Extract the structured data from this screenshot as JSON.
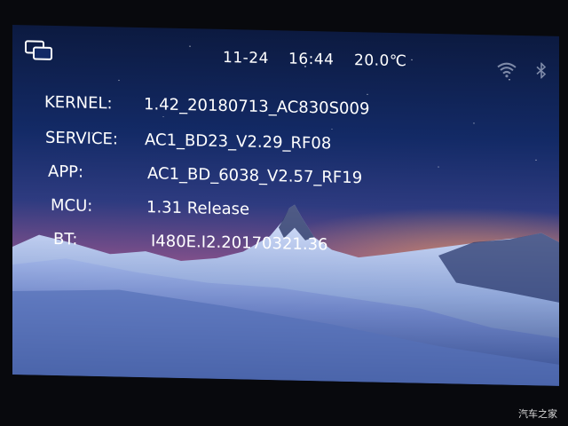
{
  "status_bar": {
    "window_icon": "window-switch-icon",
    "date": "11-24",
    "time": "16:44",
    "temperature": "20.0℃",
    "wifi_icon": "wifi-icon",
    "bluetooth_icon": "bluetooth-icon"
  },
  "version_info": {
    "kernel": {
      "label": "KERNEL:",
      "value": "1.42_20180713_AC830S009"
    },
    "service": {
      "label": "SERVICE:",
      "value": "AC1_BD23_V2.29_RF08"
    },
    "app": {
      "label": "APP:",
      "value": "AC1_BD_6038_V2.57_RF19"
    },
    "mcu": {
      "label": "MCU:",
      "value": "1.31 Release"
    },
    "bt": {
      "label": "BT:",
      "value": "I480E.I2.20170321.36"
    }
  },
  "watermark": "汽车之家",
  "colors": {
    "text": "#ffffff",
    "sky_top": "#0c1a40",
    "sky_glow": "#c98a7a",
    "bezel": "#08090d"
  }
}
